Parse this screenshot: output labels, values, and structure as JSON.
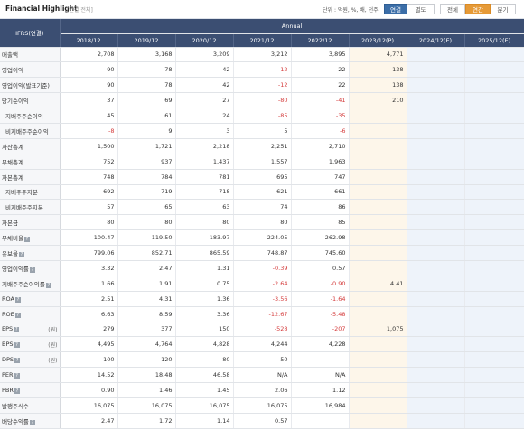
{
  "header": {
    "title": "Financial Highlight",
    "subtitle": "[연결|전체]",
    "unit": "단위 : 억원, %, 배, 천주",
    "buttons": {
      "consolidated": "연결",
      "separate": "별도",
      "all": "전체",
      "annual": "연간",
      "quarter": "분기"
    }
  },
  "table": {
    "ifrs_label": "IFRS(연결)",
    "annual_label": "Annual",
    "columns": [
      "2018/12",
      "2019/12",
      "2020/12",
      "2021/12",
      "2022/12",
      "2023/12(P)",
      "2024/12(E)",
      "2025/12(E)"
    ],
    "rows": [
      {
        "label": "매출액",
        "values": [
          "2,708",
          "3,168",
          "3,209",
          "3,212",
          "3,895",
          "4,771",
          "",
          ""
        ]
      },
      {
        "label": "영업이익",
        "values": [
          "90",
          "78",
          "42",
          "-12",
          "22",
          "138",
          "",
          ""
        ]
      },
      {
        "label": "영업이익(발표기준)",
        "values": [
          "90",
          "78",
          "42",
          "-12",
          "22",
          "138",
          "",
          ""
        ]
      },
      {
        "label": "당기순이익",
        "values": [
          "37",
          "69",
          "27",
          "-80",
          "-41",
          "210",
          "",
          ""
        ]
      },
      {
        "label": "지배주주순이익",
        "values": [
          "45",
          "61",
          "24",
          "-85",
          "-35",
          "",
          "",
          ""
        ],
        "indent": true
      },
      {
        "label": "비지배주주순이익",
        "values": [
          "-8",
          "9",
          "3",
          "5",
          "-6",
          "",
          "",
          ""
        ],
        "indent": true
      },
      {
        "label": "자산총계",
        "values": [
          "1,500",
          "1,721",
          "2,218",
          "2,251",
          "2,710",
          "",
          "",
          ""
        ]
      },
      {
        "label": "부채총계",
        "values": [
          "752",
          "937",
          "1,437",
          "1,557",
          "1,963",
          "",
          "",
          ""
        ]
      },
      {
        "label": "자본총계",
        "values": [
          "748",
          "784",
          "781",
          "695",
          "747",
          "",
          "",
          ""
        ]
      },
      {
        "label": "지배주주지분",
        "values": [
          "692",
          "719",
          "718",
          "621",
          "661",
          "",
          "",
          ""
        ],
        "indent": true
      },
      {
        "label": "비지배주주지분",
        "values": [
          "57",
          "65",
          "63",
          "74",
          "86",
          "",
          "",
          ""
        ],
        "indent": true
      },
      {
        "label": "자본금",
        "values": [
          "80",
          "80",
          "80",
          "80",
          "85",
          "",
          "",
          ""
        ]
      },
      {
        "label": "부채비율",
        "values": [
          "100.47",
          "119.50",
          "183.97",
          "224.05",
          "262.98",
          "",
          "",
          ""
        ],
        "icon": true
      },
      {
        "label": "유보율",
        "values": [
          "799.06",
          "852.71",
          "865.59",
          "748.87",
          "745.60",
          "",
          "",
          ""
        ],
        "icon": true
      },
      {
        "label": "영업이익률",
        "values": [
          "3.32",
          "2.47",
          "1.31",
          "-0.39",
          "0.57",
          "",
          "",
          ""
        ],
        "icon": true
      },
      {
        "label": "지배주주순이익률",
        "values": [
          "1.66",
          "1.91",
          "0.75",
          "-2.64",
          "-0.90",
          "4.41",
          "",
          ""
        ],
        "icon": true
      },
      {
        "label": "ROA",
        "values": [
          "2.51",
          "4.31",
          "1.36",
          "-3.56",
          "-1.64",
          "",
          "",
          ""
        ],
        "icon": true
      },
      {
        "label": "ROE",
        "values": [
          "6.63",
          "8.59",
          "3.36",
          "-12.67",
          "-5.48",
          "",
          "",
          ""
        ],
        "icon": true
      },
      {
        "label": "EPS",
        "unit": "(원)",
        "values": [
          "279",
          "377",
          "150",
          "-528",
          "-207",
          "1,075",
          "",
          ""
        ],
        "icon": true
      },
      {
        "label": "BPS",
        "unit": "(원)",
        "values": [
          "4,495",
          "4,764",
          "4,828",
          "4,244",
          "4,228",
          "",
          "",
          ""
        ],
        "icon": true
      },
      {
        "label": "DPS",
        "unit": "(원)",
        "values": [
          "100",
          "120",
          "80",
          "50",
          "",
          "",
          "",
          ""
        ],
        "icon": true
      },
      {
        "label": "PER",
        "values": [
          "14.52",
          "18.48",
          "46.58",
          "N/A",
          "N/A",
          "",
          "",
          ""
        ],
        "icon": true
      },
      {
        "label": "PBR",
        "values": [
          "0.90",
          "1.46",
          "1.45",
          "2.06",
          "1.12",
          "",
          "",
          ""
        ],
        "icon": true
      },
      {
        "label": "발행주식수",
        "values": [
          "16,075",
          "16,075",
          "16,075",
          "16,075",
          "16,984",
          "",
          "",
          ""
        ]
      },
      {
        "label": "배당수익률",
        "values": [
          "2.47",
          "1.72",
          "1.14",
          "0.57",
          "",
          "",
          "",
          ""
        ],
        "icon": true
      }
    ]
  }
}
